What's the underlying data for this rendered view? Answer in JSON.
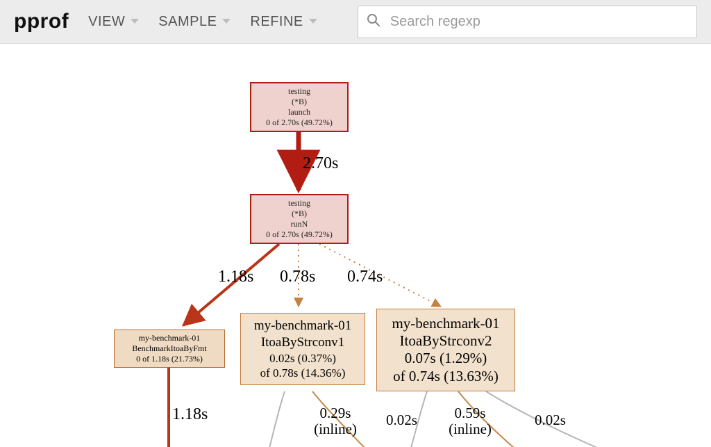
{
  "toolbar": {
    "brand": "pprof",
    "menu": {
      "view": "VIEW",
      "sample": "SAMPLE",
      "refine": "REFINE"
    },
    "search_placeholder": "Search regexp"
  },
  "nodes": {
    "launch": {
      "pkg": "testing",
      "type": "(*B)",
      "fn": "launch",
      "stat": "0 of 2.70s (49.72%)"
    },
    "runN": {
      "pkg": "testing",
      "type": "(*B)",
      "fn": "runN",
      "stat": "0 of 2.70s (49.72%)"
    },
    "fmt": {
      "pkg": "my-benchmark-01",
      "fn": "BenchmarkItoaByFmt",
      "stat": "0 of 1.18s (21.73%)"
    },
    "strconv1": {
      "pkg": "my-benchmark-01",
      "fn": "ItoaByStrconv1",
      "self": "0.02s (0.37%)",
      "cum": "of 0.78s (14.36%)"
    },
    "strconv2": {
      "pkg": "my-benchmark-01",
      "fn": "ItoaByStrconv2",
      "self": "0.07s (1.29%)",
      "cum": "of 0.74s (13.63%)"
    }
  },
  "edges": {
    "launch_runN": "2.70s",
    "runN_fmt": "1.18s",
    "runN_s1": "0.78s",
    "runN_s2": "0.74s",
    "fmt_down": "1.18s",
    "s1_a": "0.29s",
    "s1_a_sub": "(inline)",
    "s1_b": "0.02s",
    "s2_a": "0.59s",
    "s2_a_sub": "(inline)",
    "s2_b": "0.02s"
  },
  "chart_data": {
    "type": "callgraph",
    "unit": "seconds",
    "total_sampled_cum": 2.7,
    "nodes": [
      {
        "id": "launch",
        "label": "testing.(*B).launch",
        "self": 0,
        "cum": 2.7,
        "cum_pct": 49.72
      },
      {
        "id": "runN",
        "label": "testing.(*B).runN",
        "self": 0,
        "cum": 2.7,
        "cum_pct": 49.72
      },
      {
        "id": "BenchmarkItoaByFmt",
        "label": "my-benchmark-01.BenchmarkItoaByFmt",
        "self": 0,
        "cum": 1.18,
        "cum_pct": 21.73
      },
      {
        "id": "ItoaByStrconv1",
        "label": "my-benchmark-01.ItoaByStrconv1",
        "self": 0.02,
        "self_pct": 0.37,
        "cum": 0.78,
        "cum_pct": 14.36
      },
      {
        "id": "ItoaByStrconv2",
        "label": "my-benchmark-01.ItoaByStrconv2",
        "self": 0.07,
        "self_pct": 1.29,
        "cum": 0.74,
        "cum_pct": 13.63
      }
    ],
    "edges": [
      {
        "from": "launch",
        "to": "runN",
        "weight": 2.7,
        "style": "solid"
      },
      {
        "from": "runN",
        "to": "BenchmarkItoaByFmt",
        "weight": 1.18,
        "style": "solid"
      },
      {
        "from": "runN",
        "to": "ItoaByStrconv1",
        "weight": 0.78,
        "style": "dotted"
      },
      {
        "from": "runN",
        "to": "ItoaByStrconv2",
        "weight": 0.74,
        "style": "dotted"
      },
      {
        "from": "BenchmarkItoaByFmt",
        "to": "(child)",
        "weight": 1.18,
        "style": "solid"
      },
      {
        "from": "ItoaByStrconv1",
        "to": "(child)",
        "weight": 0.29,
        "inline": true,
        "style": "solid"
      },
      {
        "from": "ItoaByStrconv1",
        "to": "(child)",
        "weight": 0.02,
        "style": "solid"
      },
      {
        "from": "ItoaByStrconv2",
        "to": "(child)",
        "weight": 0.59,
        "inline": true,
        "style": "solid"
      },
      {
        "from": "ItoaByStrconv2",
        "to": "(child)",
        "weight": 0.02,
        "style": "solid"
      }
    ]
  }
}
